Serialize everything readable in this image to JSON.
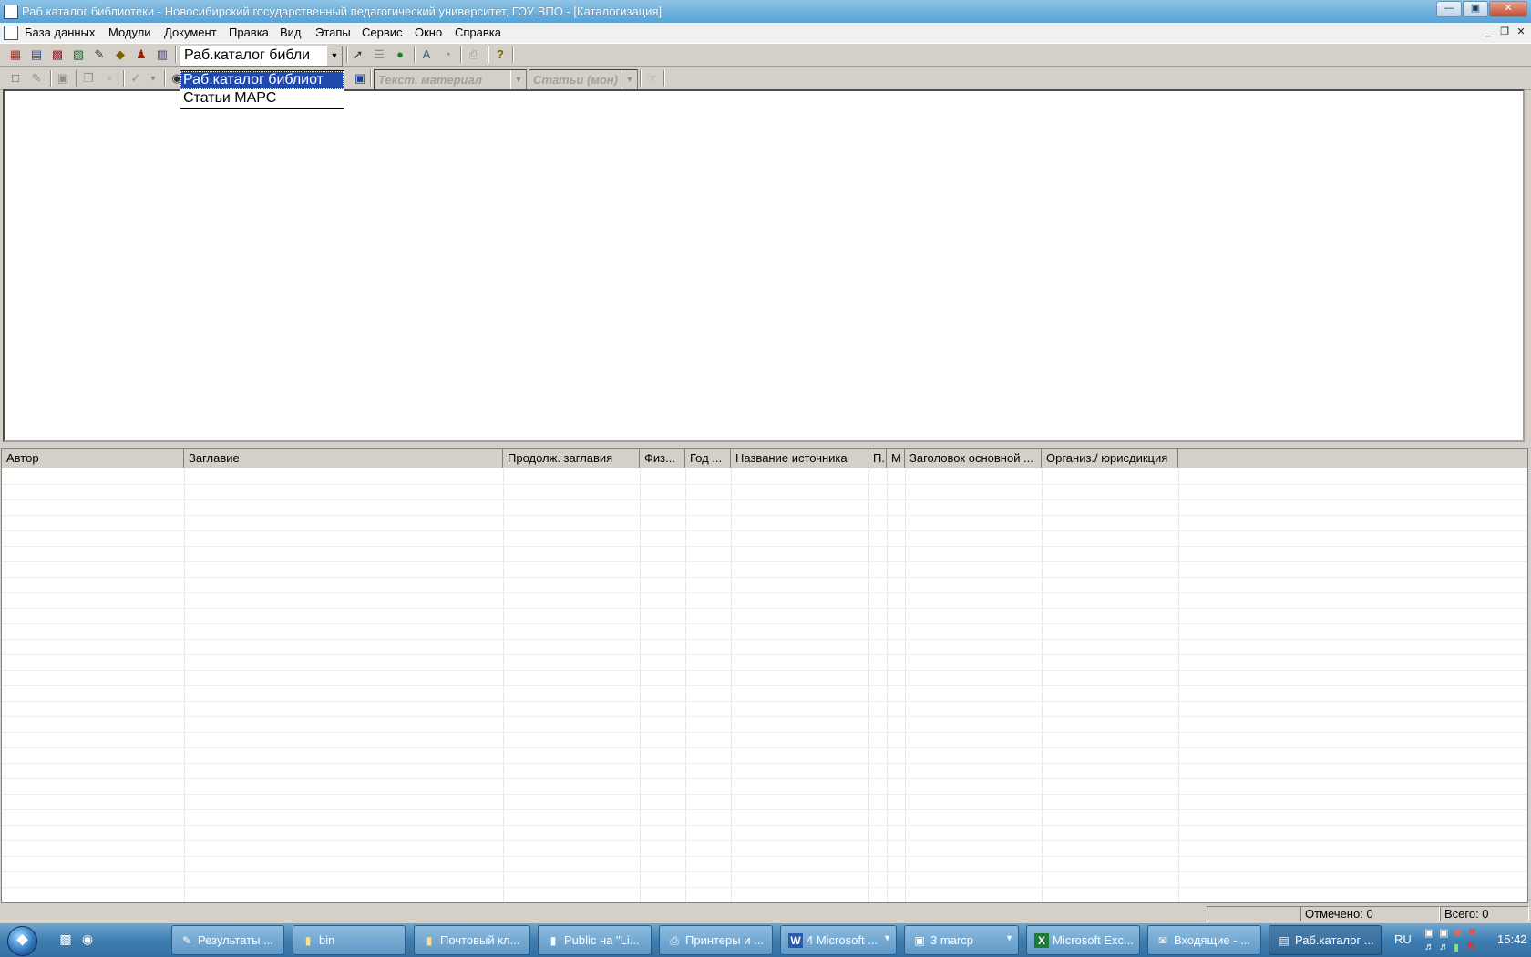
{
  "window": {
    "title": "Раб.каталог библиотеки - Новосибирский государственный педагогический университет, ГОУ ВПО - [Каталогизация]"
  },
  "menu": {
    "items": [
      "База данных",
      "Модули",
      "Документ",
      "Правка",
      "Вид",
      "Этапы",
      "Сервис",
      "Окно",
      "Справка"
    ]
  },
  "toolbar": {
    "database_combo_value": "Раб.каталог библи",
    "material_combo_value": "Текст. материал",
    "type_combo_value": "Статьи (мон)"
  },
  "dropdown": {
    "options": [
      "Раб.каталог библиот",
      "Статьи МАРС"
    ],
    "selected_index": 0
  },
  "grid": {
    "columns": [
      "Автор",
      "Заглавие",
      "Продолж. заглавия",
      "Физ...",
      "Год ...",
      "Название источника",
      "П.",
      "М",
      "Заголовок основной ...",
      "Организ./ юрисдикция"
    ]
  },
  "status": {
    "marked": "Отмечено: 0",
    "total": "Всего: 0"
  },
  "taskbar": {
    "buttons": [
      {
        "label": "Результаты ...",
        "icon": "search-results-icon"
      },
      {
        "label": "bin",
        "icon": "folder-icon"
      },
      {
        "label": "Почтовый кл...",
        "icon": "folder-icon"
      },
      {
        "label": "Public на \"Li...",
        "icon": "network-folder-icon"
      },
      {
        "label": "Принтеры и ...",
        "icon": "printer-icon"
      },
      {
        "label": "4 Microsoft ...",
        "icon": "word-icon"
      },
      {
        "label": "3 marcp",
        "icon": "app-icon"
      },
      {
        "label": "Microsoft Exc...",
        "icon": "excel-icon"
      },
      {
        "label": "Входящие - ...",
        "icon": "mail-icon"
      },
      {
        "label": "Раб.каталог ...",
        "icon": "catalog-app-icon"
      }
    ],
    "language": "RU",
    "clock": "15:42"
  }
}
